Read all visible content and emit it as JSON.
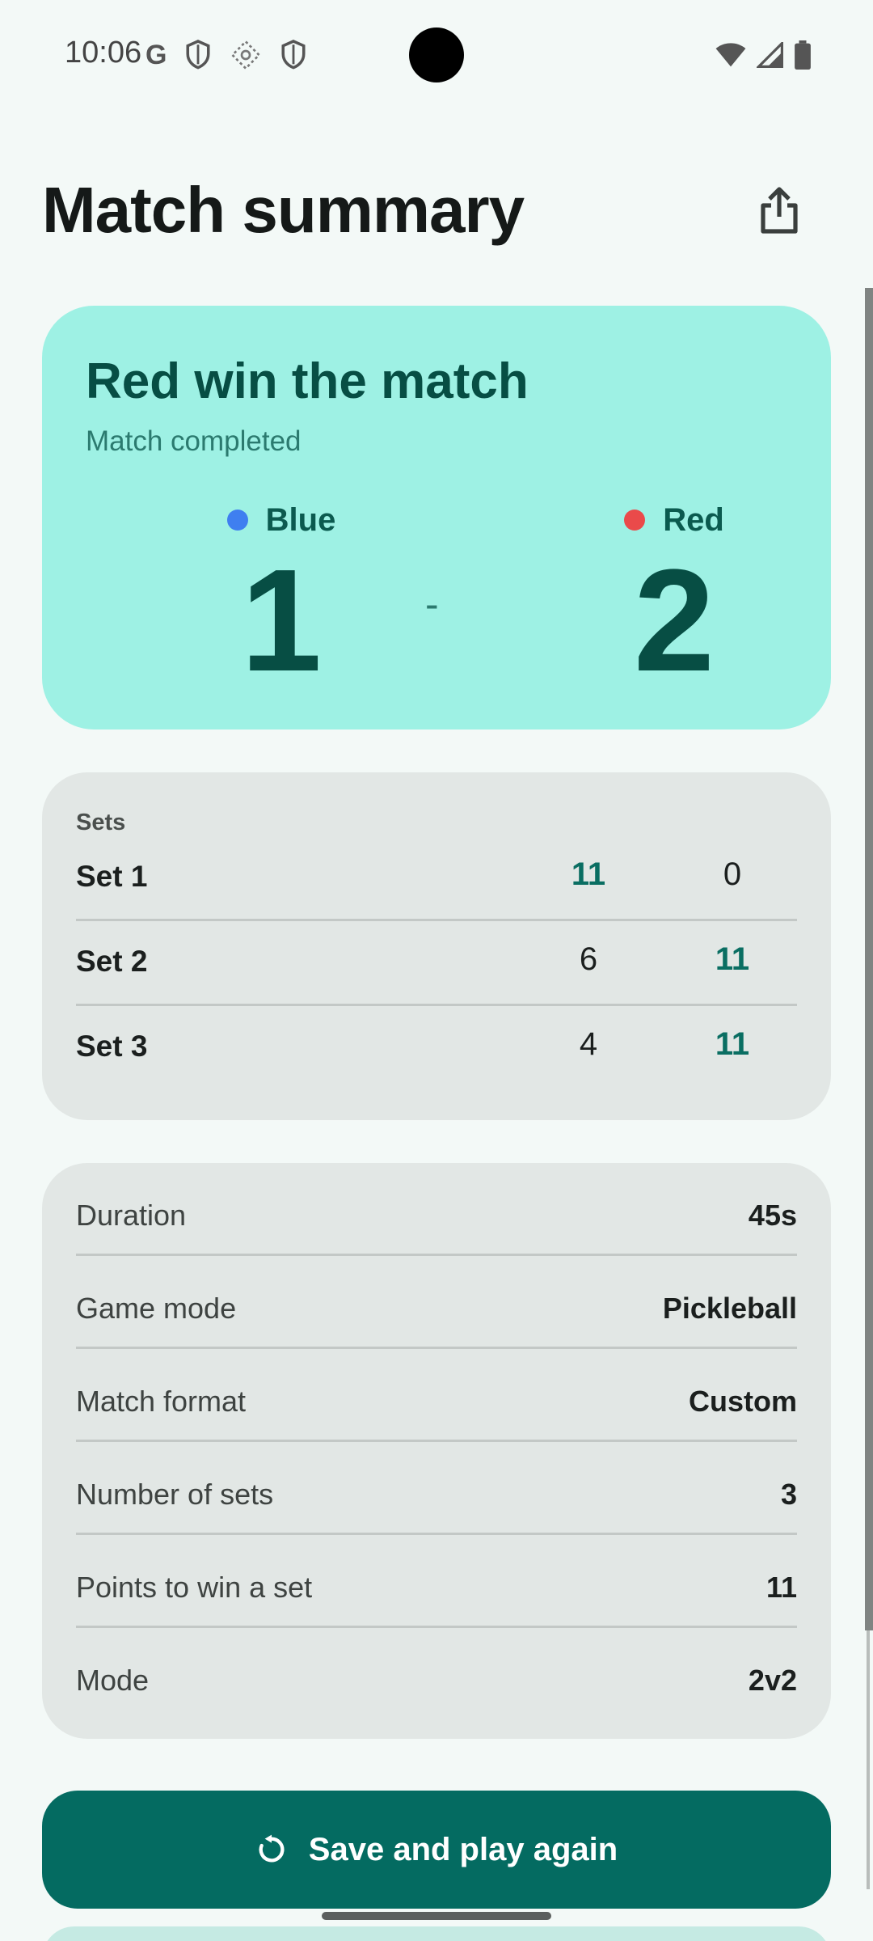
{
  "status_bar": {
    "time": "10:06",
    "left_icons": [
      "google-icon",
      "shield-icon",
      "data-saver-icon",
      "shield-icon"
    ],
    "right_icons": [
      "wifi-icon",
      "signal-icon",
      "battery-icon"
    ]
  },
  "header": {
    "title": "Match summary",
    "share_icon": "share-icon"
  },
  "result": {
    "title": "Red win the match",
    "subtitle": "Match completed",
    "separator": "-",
    "teams": [
      {
        "name": "Blue",
        "score": "1",
        "color": "#3f7ff0"
      },
      {
        "name": "Red",
        "score": "2",
        "color": "#ea4a4a"
      }
    ]
  },
  "sets": {
    "heading": "Sets",
    "rows": [
      {
        "label": "Set 1",
        "blue": "11",
        "red": "0",
        "winner": "blue"
      },
      {
        "label": "Set 2",
        "blue": "6",
        "red": "11",
        "winner": "red"
      },
      {
        "label": "Set 3",
        "blue": "4",
        "red": "11",
        "winner": "red"
      }
    ]
  },
  "details": [
    {
      "label": "Duration",
      "value": "45s"
    },
    {
      "label": "Game mode",
      "value": "Pickleball"
    },
    {
      "label": "Match format",
      "value": "Custom"
    },
    {
      "label": "Number of sets",
      "value": "3"
    },
    {
      "label": "Points to win a set",
      "value": "11"
    },
    {
      "label": "Mode",
      "value": "2v2"
    }
  ],
  "actions": {
    "primary_label": "Save and play again",
    "primary_icon": "replay-icon"
  },
  "colors": {
    "accent": "#046b61",
    "result_card": "#9ef1e4",
    "winner_value": "#0a6e62"
  }
}
